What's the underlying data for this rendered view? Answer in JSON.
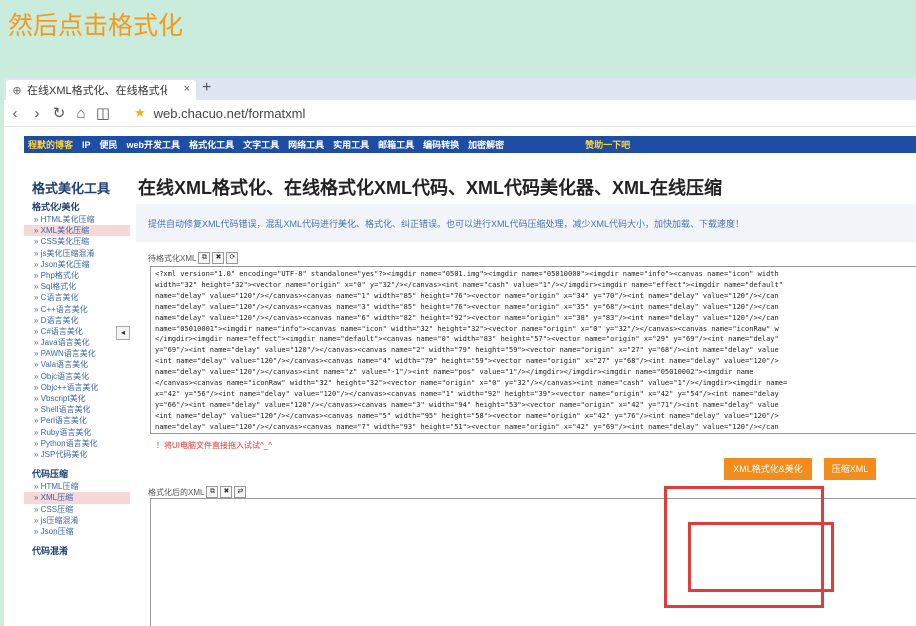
{
  "caption": "然后点击格式化",
  "tab": {
    "title": "在线XML格式化、在线格式化",
    "close": "×",
    "new": "+"
  },
  "address": {
    "url": "web.chacuo.net/formatxml"
  },
  "sitenav": {
    "logo": "程默的博客",
    "items": [
      "IP",
      "便民",
      "web开发工具",
      "格式化工具",
      "文字工具",
      "网络工具",
      "实用工具",
      "邮箱工具",
      "编码转换",
      "加密解密"
    ],
    "donate": "赞助一下吧"
  },
  "sidebar": {
    "title": "格式美化工具",
    "section1": "格式化/美化",
    "items1": [
      "HTML美化压缩",
      "XML美化压缩",
      "CSS美化压缩",
      "js美化压缩混淆",
      "Json美化压缩",
      "Php格式化",
      "Sql格式化",
      "C语言美化",
      "C++语言美化",
      "D语言美化",
      "C#语言美化",
      "Java语言美化",
      "PAWN语言美化",
      "Vala语言美化",
      "Objc语言美化",
      "Objc++语言美化",
      "Vbscript美化",
      "Shell语言美化",
      "Perl语言美化",
      "Ruby语言美化",
      "Python语言美化",
      "JSP代码美化"
    ],
    "section2": "代码压缩",
    "items2": [
      "HTML压缩",
      "XML压缩",
      "CSS压缩",
      "js压缩混淆",
      "Json压缩"
    ],
    "section3": "代码混淆",
    "collapse": "◂"
  },
  "main": {
    "title": "在线XML格式化、在线格式化XML代码、XML代码美化器、XML在线压缩",
    "desc": "提供自动修复XML代码错误，混乱XML代码进行美化、格式化、纠正错误。也可以进行XML代码压缩处理，减少XML代码大小，加快加载、下载速度！",
    "input_label": "待格式化XML",
    "output_label": "格式化后的XML",
    "icons": [
      "⧉",
      "✖",
      "⟳"
    ],
    "code_lines": [
      "<?xml version=\"1.0\" encoding=\"UTF-8\" standalone=\"yes\"?><imgdir name=\"0501.img\"><imgdir name=\"05010000\"><imgdir name=\"info\"><canvas name=\"icon\" width",
      "width=\"32\" height=\"32\"><vector name=\"origin\" x=\"0\" y=\"32\"/></canvas><int name=\"cash\" value=\"1\"/></imgdir><imgdir name=\"effect\"><imgdir name=\"default\"",
      "name=\"delay\" value=\"120\"/></canvas><canvas name=\"1\" width=\"85\" height=\"76\"><vector name=\"origin\" x=\"34\" y=\"70\"/><int name=\"delay\" value=\"120\"/></can",
      "name=\"delay\" value=\"120\"/></canvas><canvas name=\"3\" width=\"85\" height=\"76\"><vector name=\"origin\" x=\"35\" y=\"68\"/><int name=\"delay\" value=\"120\"/></can",
      "name=\"delay\" value=\"120\"/></canvas><canvas name=\"6\" width=\"82\" height=\"92\"><vector name=\"origin\" x=\"38\" y=\"83\"/><int name=\"delay\" value=\"120\"/></can",
      "name=\"05010001\"><imgdir name=\"info\"><canvas name=\"icon\" width=\"32\" height=\"32\"><vector name=\"origin\" x=\"0\" y=\"32\"/></canvas><canvas name=\"iconRaw\" w",
      "</imgdir><imgdir name=\"effect\"><imgdir name=\"default\"><canvas name=\"0\" width=\"83\" height=\"57\"><vector name=\"origin\" x=\"29\" y=\"69\"/><int name=\"delay\"",
      "y=\"69\"/><int name=\"delay\" value=\"120\"/></canvas><canvas name=\"2\" width=\"79\" height=\"59\"><vector name=\"origin\" x=\"27\" y=\"68\"/><int name=\"delay\" value",
      "<int name=\"delay\" value=\"120\"/></canvas><canvas name=\"4\" width=\"79\" height=\"59\"><vector name=\"origin\" x=\"27\" y=\"68\"/><int name=\"delay\" value=\"120\"/>",
      "name=\"delay\" value=\"120\"/></canvas><int name=\"z\" value=\"-1\"/><int name=\"pos\" value=\"1\"/></imgdir></imgdir><imgdir name=\"05010002\"><imgdir name",
      "</canvas><canvas name=\"iconRaw\" width=\"32\" height=\"32\"><vector name=\"origin\" x=\"0\" y=\"32\"/></canvas><int name=\"cash\" value=\"1\"/></imgdir><imgdir name=",
      "x=\"42\" y=\"56\"/><int name=\"delay\" value=\"120\"/></canvas><canvas name=\"1\" width=\"92\" height=\"39\"><vector name=\"origin\" x=\"42\" y=\"54\"/><int name=\"delay",
      "y=\"66\"/><int name=\"delay\" value=\"120\"/></canvas><canvas name=\"3\" width=\"94\" height=\"53\"><vector name=\"origin\" x=\"42\" y=\"71\"/><int name=\"delay\" value",
      "<int name=\"delay\" value=\"120\"/></canvas><canvas name=\"5\" width=\"95\" height=\"58\"><vector name=\"origin\" x=\"42\" y=\"76\"/><int name=\"delay\" value=\"120\"/>",
      "name=\"delay\" value=\"120\"/></canvas><canvas name=\"7\" width=\"93\" height=\"51\"><vector name=\"origin\" x=\"42\" y=\"69\"/><int name=\"delay\" value=\"120\"/></can"
    ],
    "tip": "！将UI电脑文件直接拖入试试^_^",
    "format_button": "XML格式化&美化",
    "compress_button": "压缩XML"
  }
}
